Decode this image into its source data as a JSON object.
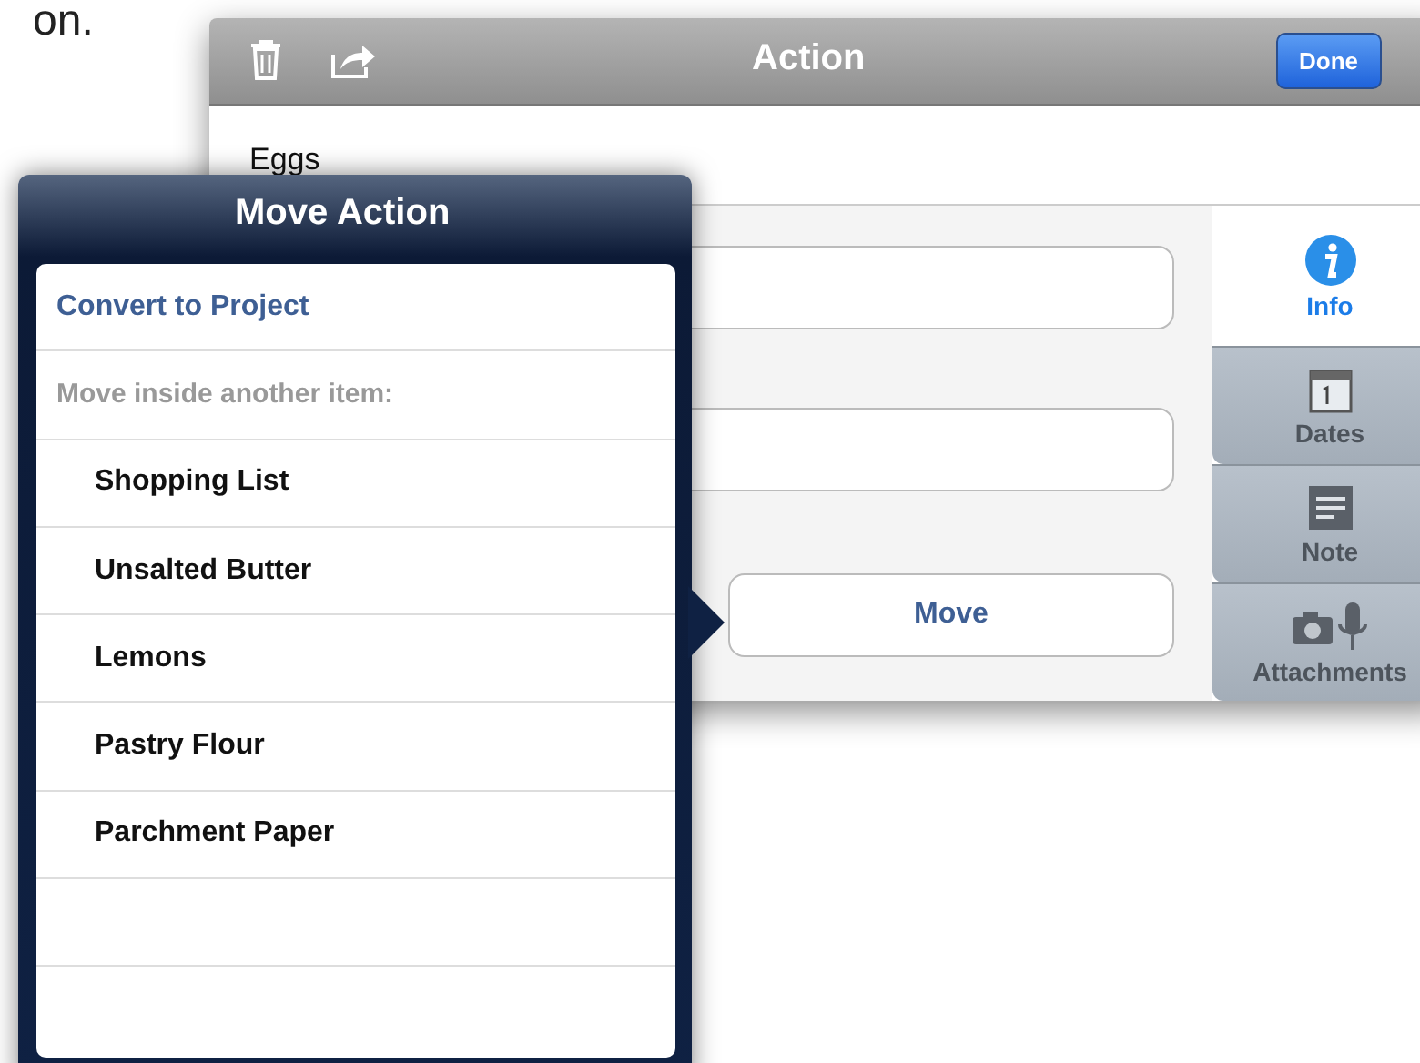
{
  "caption": "on.",
  "toolbar": {
    "title": "Action",
    "done": "Done"
  },
  "action_name": "Eggs",
  "move_button": "Move",
  "tabs": [
    {
      "label": "Info",
      "selected": true
    },
    {
      "label": "Dates",
      "selected": false
    },
    {
      "label": "Note",
      "selected": false
    },
    {
      "label": "Attachments",
      "selected": false
    }
  ],
  "popover": {
    "title": "Move Action",
    "convert": "Convert to Project",
    "section": "Move inside another item:",
    "items": [
      "Shopping List",
      "Unsalted Butter",
      "Lemons",
      "Pastry Flour",
      "Parchment Paper"
    ]
  }
}
